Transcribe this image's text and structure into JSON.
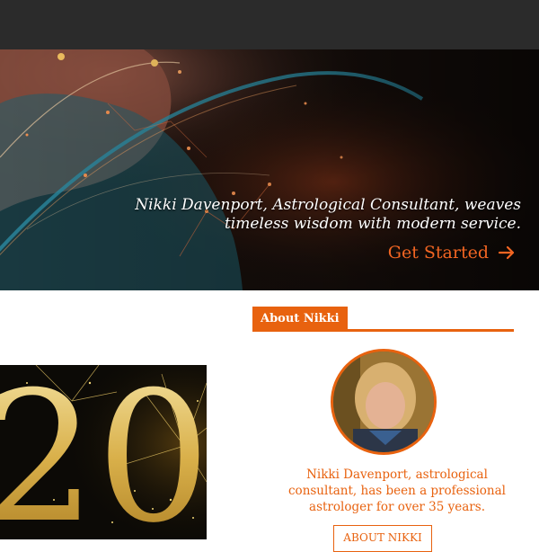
{
  "hero": {
    "tagline_line1": "Nikki Davenport, Astrological Consultant, weaves",
    "tagline_line2": "timeless wisdom with modern service.",
    "cta_label": "Get Started",
    "cta_icon": "arrow-right-icon"
  },
  "about": {
    "section_title": "About Nikki",
    "bio_line1": "Nikki Davenport, astrological",
    "bio_line2": "consultant, has been a professional",
    "bio_line3": "astrologer for over 35 years.",
    "button_label": "ABOUT NIKKI"
  },
  "promo": {
    "numerals": "20"
  },
  "colors": {
    "accent": "#e8620f",
    "topbar": "#2b2b2b",
    "hero_text": "#ffffff"
  }
}
